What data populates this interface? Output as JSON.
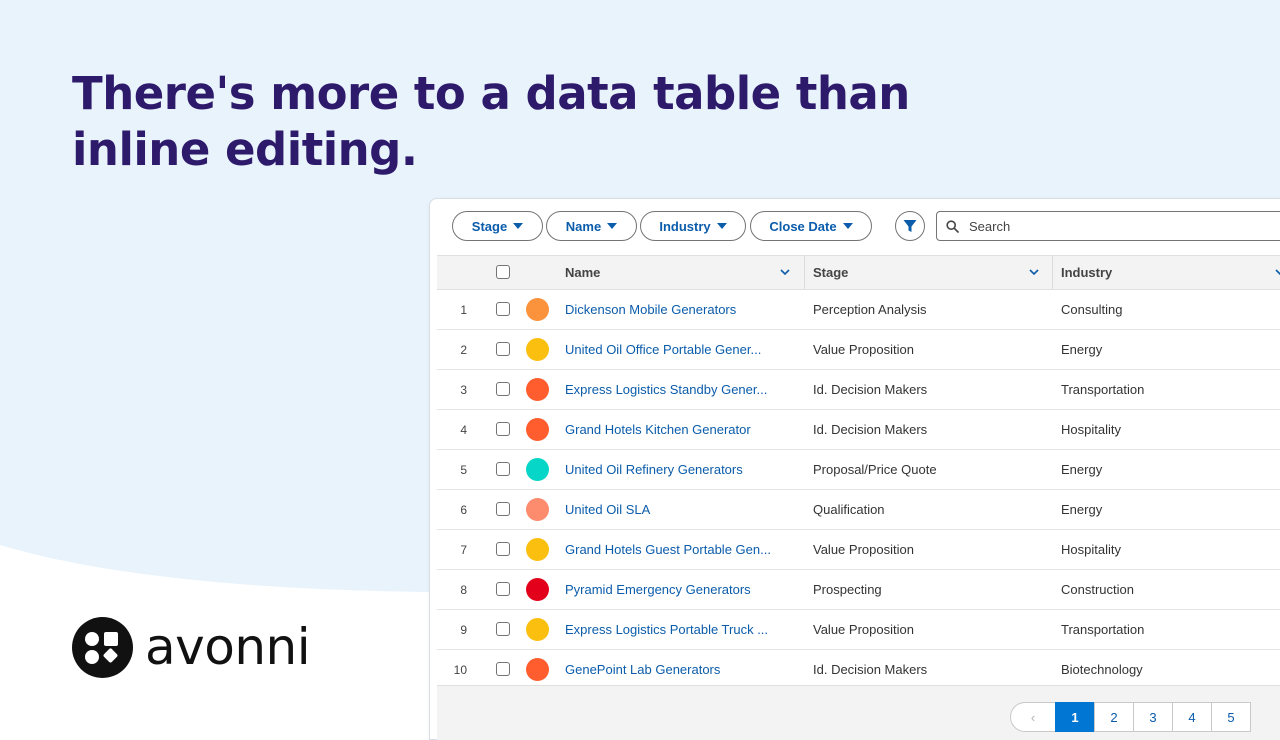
{
  "headline": "There's more to a data table than inline editing.",
  "brand": {
    "name": "avonni"
  },
  "colors": {
    "headline": "#2e1a6b",
    "link": "#0b5cab",
    "accent": "#0176d3",
    "background_tint": "#e9f3fc"
  },
  "toolbar": {
    "filters": [
      {
        "label": "Stage"
      },
      {
        "label": "Name"
      },
      {
        "label": "Industry"
      },
      {
        "label": "Close Date"
      }
    ],
    "filter_icon": "filter-icon",
    "search": {
      "placeholder": "Search",
      "value": ""
    }
  },
  "table": {
    "columns": [
      {
        "label": "Name"
      },
      {
        "label": "Stage"
      },
      {
        "label": "Industry"
      }
    ],
    "rows": [
      {
        "num": "1",
        "name": "Dickenson Mobile Generators",
        "stage": "Perception Analysis",
        "industry": "Consulting",
        "color": "#fb923c"
      },
      {
        "num": "2",
        "name": "United Oil Office Portable Gener...",
        "stage": "Value Proposition",
        "industry": "Energy",
        "color": "#fbbf0f"
      },
      {
        "num": "3",
        "name": "Express Logistics Standby Gener...",
        "stage": "Id. Decision Makers",
        "industry": "Transportation",
        "color": "#ff5d2d"
      },
      {
        "num": "4",
        "name": "Grand Hotels Kitchen Generator",
        "stage": "Id. Decision Makers",
        "industry": "Hospitality",
        "color": "#ff5d2d"
      },
      {
        "num": "5",
        "name": "United Oil Refinery Generators",
        "stage": "Proposal/Price Quote",
        "industry": "Energy",
        "color": "#06d6c7"
      },
      {
        "num": "6",
        "name": "United Oil SLA",
        "stage": "Qualification",
        "industry": "Energy",
        "color": "#fd8b6e"
      },
      {
        "num": "7",
        "name": "Grand Hotels Guest Portable Gen...",
        "stage": "Value Proposition",
        "industry": "Hospitality",
        "color": "#fbbf0f"
      },
      {
        "num": "8",
        "name": "Pyramid Emergency Generators",
        "stage": "Prospecting",
        "industry": "Construction",
        "color": "#e3001b"
      },
      {
        "num": "9",
        "name": "Express Logistics Portable Truck ...",
        "stage": "Value Proposition",
        "industry": "Transportation",
        "color": "#fbbf0f"
      },
      {
        "num": "10",
        "name": "GenePoint Lab Generators",
        "stage": "Id. Decision Makers",
        "industry": "Biotechnology",
        "color": "#ff5d2d"
      }
    ]
  },
  "pagination": {
    "prev": "‹",
    "pages": [
      "1",
      "2",
      "3",
      "4",
      "5"
    ],
    "current": "1"
  }
}
